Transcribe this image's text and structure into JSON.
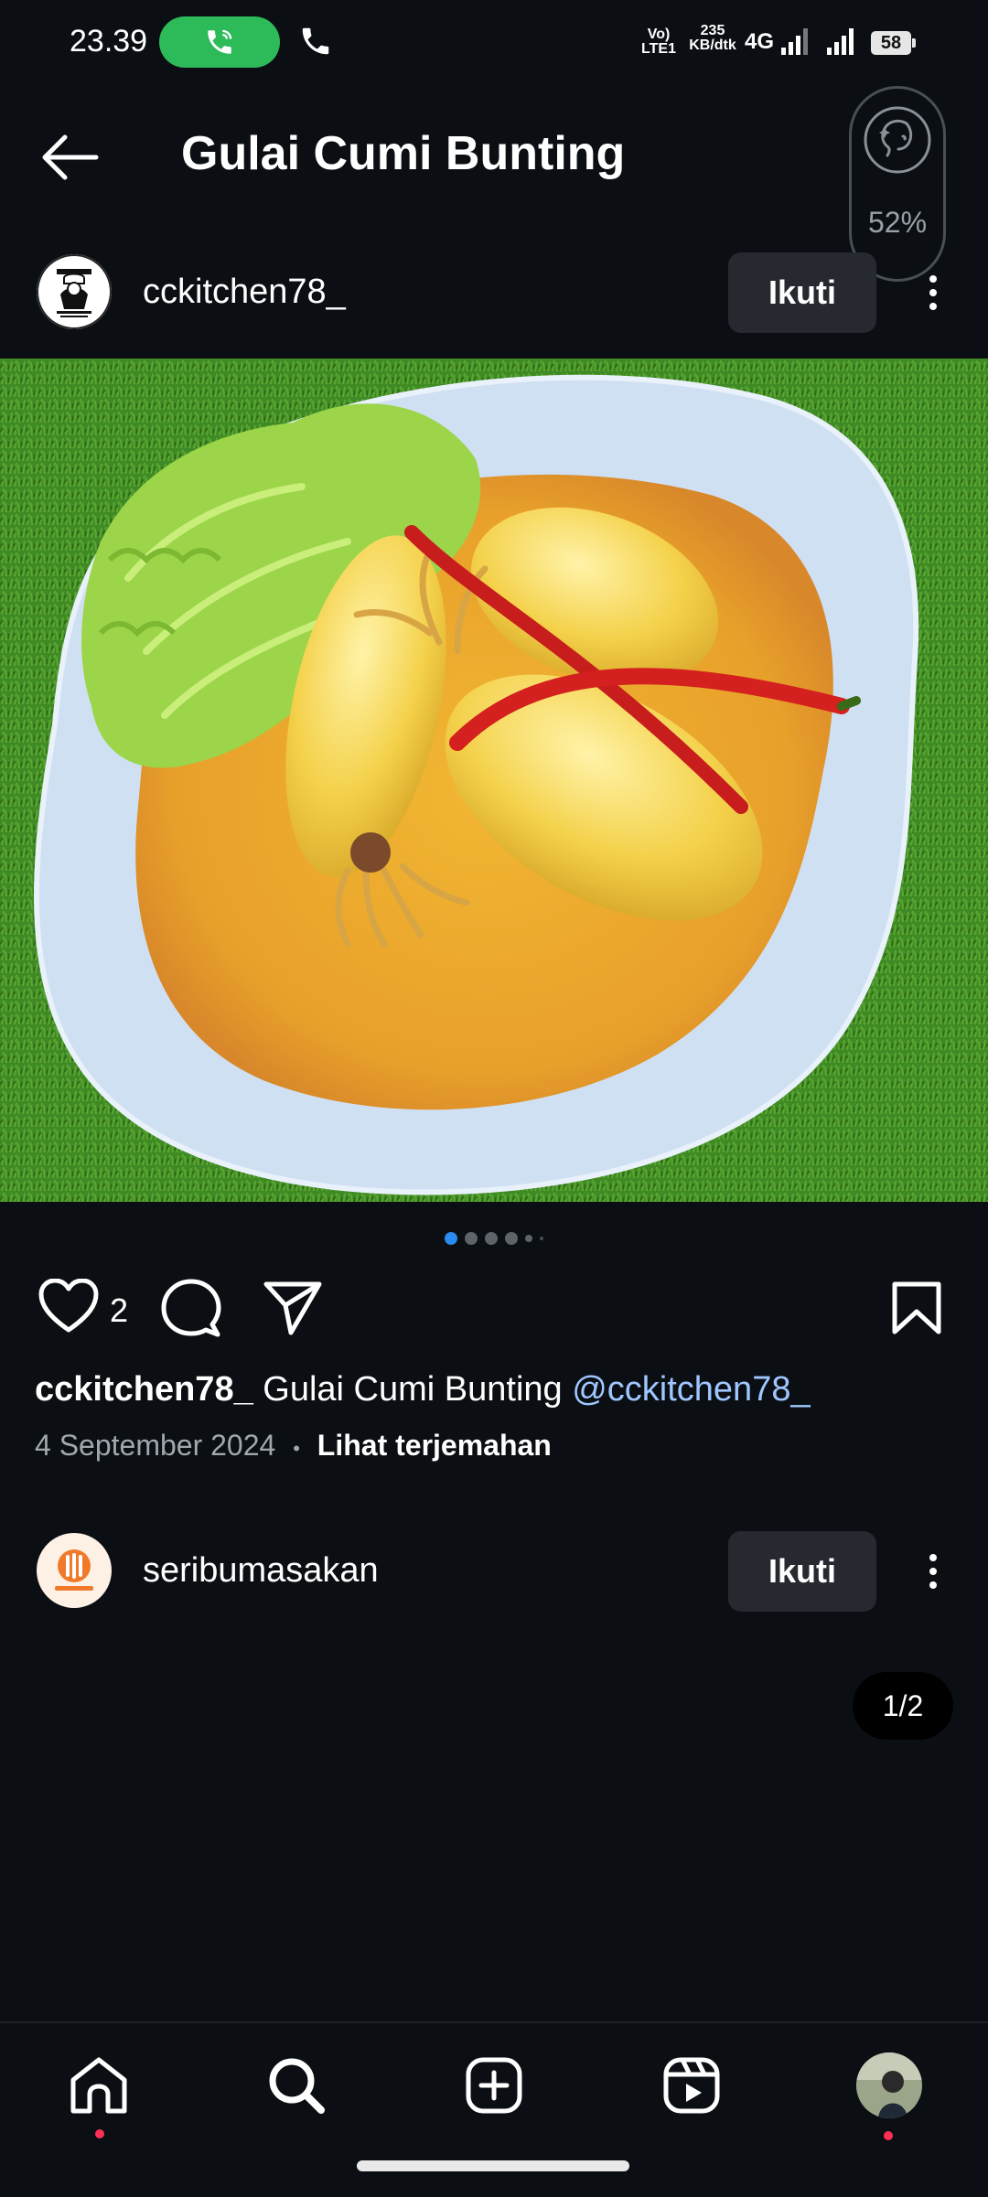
{
  "status_bar": {
    "time": "23.39",
    "volte": "Vo) LTE1",
    "net_speed_value": "235",
    "net_speed_unit": "KB/dtk",
    "network": "4G",
    "battery": "58"
  },
  "header": {
    "title": "Gulai Cumi Bunting"
  },
  "assistant_widget": {
    "percent": "52%"
  },
  "post": {
    "username": "cckitchen78_",
    "follow_label": "Ikuti",
    "carousel": {
      "total": 6,
      "active_index": 0
    },
    "likes": "2",
    "caption_user": "cckitchen78_",
    "caption_text": " Gulai  Cumi Bunting ",
    "caption_mention": "@cckitchen78_",
    "date": "4 September 2024",
    "separator": "•",
    "translate_label": "Lihat terjemahan"
  },
  "next_post": {
    "username": "seribumasakan",
    "follow_label": "Ikuti"
  },
  "page_indicator": "1/2",
  "bottom_nav": {
    "items": [
      "home-icon",
      "search-icon",
      "create-icon",
      "reels-icon",
      "profile-avatar"
    ]
  },
  "colors": {
    "background": "#0b0f14",
    "accent_blue": "#2a8cf0",
    "call_green": "#2dbb5a",
    "notification_red": "#ff2e55",
    "mention": "#9fc7ff"
  }
}
